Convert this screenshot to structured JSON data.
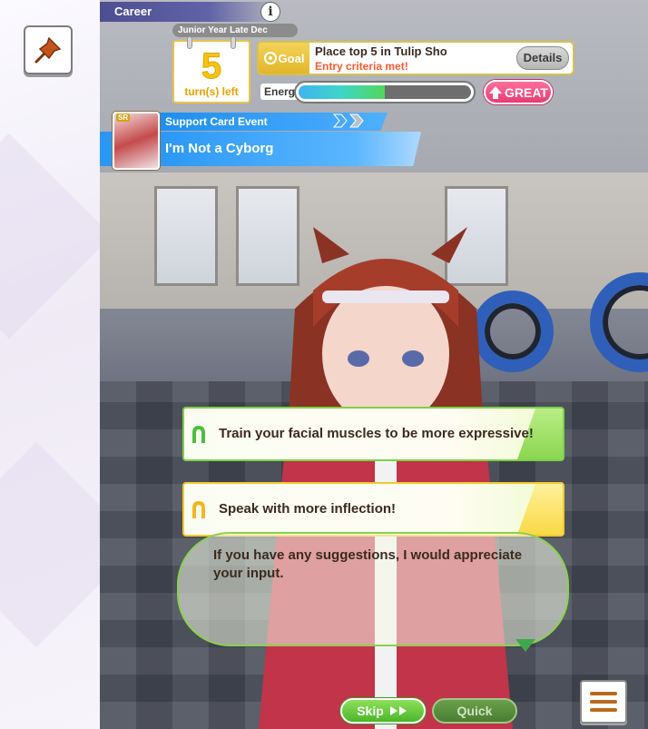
{
  "header": {
    "career_label": "Career",
    "info_icon": "i",
    "date_label": "Junior Year Late Dec"
  },
  "turns": {
    "number": "5",
    "label": "turn(s) left"
  },
  "goal": {
    "tag": "Goal",
    "title": "Place top 5 in Tulip Sho",
    "status": "Entry criteria met!",
    "details_label": "Details",
    "status_color": "#ff5a2e"
  },
  "energy": {
    "label": "Energy",
    "fill_fraction": 0.5
  },
  "mood": {
    "label": "GREAT",
    "icon": "up-arrow-icon",
    "color": "#e93a74"
  },
  "event": {
    "type_label": "Support Card Event",
    "title": "I'm Not a Cyborg",
    "card_rarity": "SR"
  },
  "choices": [
    {
      "text": "Train your facial muscles to be more expressive!",
      "color": "green",
      "icon": "horseshoe-icon"
    },
    {
      "text": "Speak with more inflection!",
      "color": "yellow",
      "icon": "horseshoe-icon"
    }
  ],
  "dialogue": {
    "text": "If you have any suggestions, I would appreciate your input."
  },
  "controls": {
    "skip_label": "Skip",
    "quick_label": "Quick",
    "menu_icon": "hamburger-menu-icon",
    "pin_icon": "pushpin-icon"
  },
  "colors": {
    "accent_blue": "#2a97f5",
    "choice_green": "#7dd046",
    "choice_yellow": "#f2c92f"
  }
}
